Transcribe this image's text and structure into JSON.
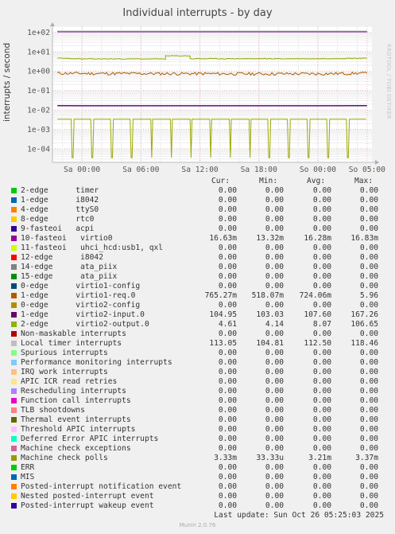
{
  "chart_data": {
    "type": "line",
    "title": "Individual interrupts - by day",
    "ylabel": "interrupts / second",
    "xlabel": "",
    "yscale": "log",
    "ylim": [
      2e-05,
      200
    ],
    "y_ticks": [
      "1e+02",
      "1e+01",
      "1e+00",
      "1e-01",
      "1e-02",
      "1e-03",
      "1e-04"
    ],
    "x_ticks": [
      "Sa 00:00",
      "Sa 06:00",
      "Sa 12:00",
      "Sa 18:00",
      "So 00:00",
      "So 05:00"
    ],
    "x_range_hours": [
      -3,
      29.5
    ],
    "grid": true,
    "legend_position": "bottom",
    "series": [
      {
        "name": "1-edge virtio2-input.0",
        "color": "#5E0C83",
        "points": [
          [
            -2.5,
            105
          ],
          [
            0,
            105
          ],
          [
            6,
            105
          ],
          [
            12,
            105
          ],
          [
            18,
            105
          ],
          [
            24,
            105
          ],
          [
            29,
            105
          ]
        ]
      },
      {
        "name": "Local timer interrupts",
        "color": "#A8A8A8",
        "points": [
          [
            -2.5,
            113
          ],
          [
            0,
            113
          ],
          [
            12,
            113
          ],
          [
            24,
            113
          ],
          [
            29,
            113
          ]
        ]
      },
      {
        "name": "1-edge virtio1-req.0",
        "color": "#B05D00",
        "points": [
          [
            -2.5,
            0.77
          ],
          [
            0,
            0.75
          ],
          [
            6,
            0.74
          ],
          [
            12,
            0.73
          ],
          [
            18,
            0.72
          ],
          [
            24,
            0.72
          ],
          [
            29,
            0.77
          ]
        ]
      },
      {
        "name": "2-edge virtio2-output.0",
        "color": "#8FA800",
        "points": [
          [
            -2.5,
            4.6
          ],
          [
            0,
            4.2
          ],
          [
            6,
            4.2
          ],
          [
            8.5,
            4.2
          ],
          [
            8.5,
            6
          ],
          [
            11,
            6
          ],
          [
            11,
            4.3
          ],
          [
            18,
            4.3
          ],
          [
            24,
            4.3
          ],
          [
            29,
            4.61
          ]
        ]
      },
      {
        "name": "10-fasteoi virtio0",
        "color": "#5E0C83",
        "points": [
          [
            -2.5,
            0.0166
          ],
          [
            0,
            0.0163
          ],
          [
            12,
            0.0163
          ],
          [
            24,
            0.0163
          ],
          [
            29,
            0.0166
          ]
        ]
      },
      {
        "name": "Machine check polls",
        "color": "#9CA800",
        "points": [
          [
            -2.5,
            0.00333
          ],
          [
            29,
            0.00333
          ]
        ]
      }
    ]
  },
  "legend": {
    "headers": {
      "cur": "Cur:",
      "min": "Min:",
      "avg": "Avg:",
      "max": "Max:"
    },
    "rows": [
      {
        "label": "2-edge      timer",
        "color": "#00CC00",
        "cur": "0.00",
        "min": "0.00",
        "avg": "0.00",
        "max": "0.00"
      },
      {
        "label": "1-edge      i8042",
        "color": "#0066B3",
        "cur": "0.00",
        "min": "0.00",
        "avg": "0.00",
        "max": "0.00"
      },
      {
        "label": "4-edge      ttyS0",
        "color": "#FF8000",
        "cur": "0.00",
        "min": "0.00",
        "avg": "0.00",
        "max": "0.00"
      },
      {
        "label": "8-edge      rtc0",
        "color": "#FFCC00",
        "cur": "0.00",
        "min": "0.00",
        "avg": "0.00",
        "max": "0.00"
      },
      {
        "label": "9-fasteoi   acpi",
        "color": "#330099",
        "cur": "0.00",
        "min": "0.00",
        "avg": "0.00",
        "max": "0.00"
      },
      {
        "label": "10-fasteoi   virtio0",
        "color": "#990099",
        "cur": "16.63m",
        "min": "13.32m",
        "avg": "16.28m",
        "max": "16.83m"
      },
      {
        "label": "11-fasteoi   uhci_hcd:usb1, qxl",
        "color": "#CCFF00",
        "cur": "0.00",
        "min": "0.00",
        "avg": "0.00",
        "max": "0.00"
      },
      {
        "label": "12-edge      i8042",
        "color": "#FF0000",
        "cur": "0.00",
        "min": "0.00",
        "avg": "0.00",
        "max": "0.00"
      },
      {
        "label": "14-edge      ata_piix",
        "color": "#808080",
        "cur": "0.00",
        "min": "0.00",
        "avg": "0.00",
        "max": "0.00"
      },
      {
        "label": "15-edge      ata_piix",
        "color": "#008F00",
        "cur": "0.00",
        "min": "0.00",
        "avg": "0.00",
        "max": "0.00"
      },
      {
        "label": "0-edge      virtio1-config",
        "color": "#00487D",
        "cur": "0.00",
        "min": "0.00",
        "avg": "0.00",
        "max": "0.00"
      },
      {
        "label": "1-edge      virtio1-req.0",
        "color": "#B35A00",
        "cur": "765.27m",
        "min": "518.07m",
        "avg": "724.06m",
        "max": "5.96"
      },
      {
        "label": "0-edge      virtio2-config",
        "color": "#B38F00",
        "cur": "0.00",
        "min": "0.00",
        "avg": "0.00",
        "max": "0.00"
      },
      {
        "label": "1-edge      virtio2-input.0",
        "color": "#6B006B",
        "cur": "104.95",
        "min": "103.03",
        "avg": "107.60",
        "max": "167.26"
      },
      {
        "label": "2-edge      virtio2-output.0",
        "color": "#8FB300",
        "cur": "4.61",
        "min": "4.14",
        "avg": "8.07",
        "max": "106.65"
      },
      {
        "label": "Non-maskable interrupts",
        "color": "#B30000",
        "cur": "0.00",
        "min": "0.00",
        "avg": "0.00",
        "max": "0.00"
      },
      {
        "label": "Local timer interrupts",
        "color": "#BEBEBE",
        "cur": "113.05",
        "min": "104.81",
        "avg": "112.50",
        "max": "118.46"
      },
      {
        "label": "Spurious interrupts",
        "color": "#80FF80",
        "cur": "0.00",
        "min": "0.00",
        "avg": "0.00",
        "max": "0.00"
      },
      {
        "label": "Performance monitoring interrupts",
        "color": "#80C9FF",
        "cur": "0.00",
        "min": "0.00",
        "avg": "0.00",
        "max": "0.00"
      },
      {
        "label": "IRQ work interrupts",
        "color": "#FFC080",
        "cur": "0.00",
        "min": "0.00",
        "avg": "0.00",
        "max": "0.00"
      },
      {
        "label": "APIC ICR read retries",
        "color": "#FFE680",
        "cur": "0.00",
        "min": "0.00",
        "avg": "0.00",
        "max": "0.00"
      },
      {
        "label": "Rescheduling interrupts",
        "color": "#AA80FF",
        "cur": "0.00",
        "min": "0.00",
        "avg": "0.00",
        "max": "0.00"
      },
      {
        "label": "Function call interrupts",
        "color": "#EE00CC",
        "cur": "0.00",
        "min": "0.00",
        "avg": "0.00",
        "max": "0.00"
      },
      {
        "label": "TLB shootdowns",
        "color": "#FF8080",
        "cur": "0.00",
        "min": "0.00",
        "avg": "0.00",
        "max": "0.00"
      },
      {
        "label": "Thermal event interrupts",
        "color": "#666600",
        "cur": "0.00",
        "min": "0.00",
        "avg": "0.00",
        "max": "0.00"
      },
      {
        "label": "Threshold APIC interrupts",
        "color": "#FFBFFF",
        "cur": "0.00",
        "min": "0.00",
        "avg": "0.00",
        "max": "0.00"
      },
      {
        "label": "Deferred Error APIC interrupts",
        "color": "#00FFCC",
        "cur": "0.00",
        "min": "0.00",
        "avg": "0.00",
        "max": "0.00"
      },
      {
        "label": "Machine check exceptions",
        "color": "#CC6699",
        "cur": "0.00",
        "min": "0.00",
        "avg": "0.00",
        "max": "0.00"
      },
      {
        "label": "Machine check polls",
        "color": "#999900",
        "cur": "3.33m",
        "min": "33.33u",
        "avg": "3.21m",
        "max": "3.37m"
      },
      {
        "label": "ERR",
        "color": "#00CC00",
        "cur": "0.00",
        "min": "0.00",
        "avg": "0.00",
        "max": "0.00"
      },
      {
        "label": "MIS",
        "color": "#0066B3",
        "cur": "0.00",
        "min": "0.00",
        "avg": "0.00",
        "max": "0.00"
      },
      {
        "label": "Posted-interrupt notification event",
        "color": "#FF8000",
        "cur": "0.00",
        "min": "0.00",
        "avg": "0.00",
        "max": "0.00"
      },
      {
        "label": "Nested posted-interrupt event",
        "color": "#FFCC00",
        "cur": "0.00",
        "min": "0.00",
        "avg": "0.00",
        "max": "0.00"
      },
      {
        "label": "Posted-interrupt wakeup event",
        "color": "#330099",
        "cur": "0.00",
        "min": "0.00",
        "avg": "0.00",
        "max": "0.00"
      }
    ]
  },
  "footer": {
    "last_update": "Last update: Sun Oct 26 05:25:03 2025",
    "munin": "Munin 2.0.76",
    "side_text": "RRDTOOL / TOBI OETIKER"
  }
}
